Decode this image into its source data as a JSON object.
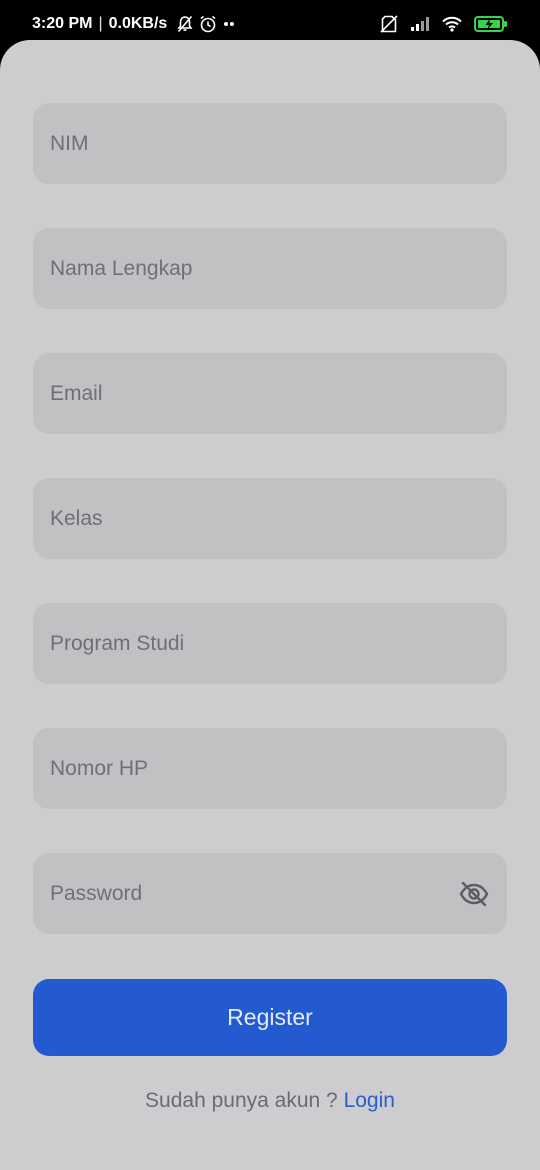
{
  "status_bar": {
    "time": "3:20 PM",
    "separator": "|",
    "network_speed": "0.0KB/s",
    "icons_left": [
      "muted-bell-icon",
      "alarm-clock-icon",
      "more-dots-icon"
    ],
    "icons_right": [
      "no-sim-icon",
      "signal-icon",
      "wifi-icon",
      "battery-charging-icon"
    ]
  },
  "form": {
    "fields": [
      {
        "name": "nim-input",
        "placeholder": "NIM",
        "value": ""
      },
      {
        "name": "nama-lengkap-input",
        "placeholder": "Nama Lengkap",
        "value": ""
      },
      {
        "name": "email-input",
        "placeholder": "Email",
        "value": ""
      },
      {
        "name": "kelas-input",
        "placeholder": "Kelas",
        "value": ""
      },
      {
        "name": "program-studi-input",
        "placeholder": "Program Studi",
        "value": ""
      },
      {
        "name": "nomor-hp-input",
        "placeholder": "Nomor HP",
        "value": ""
      },
      {
        "name": "password-input",
        "placeholder": "Password",
        "value": ""
      }
    ],
    "password_toggle_icon": "eye-off-icon",
    "register_label": "Register"
  },
  "footer": {
    "prompt": "Sudah punya akun ?",
    "login_label": "Login"
  },
  "colors": {
    "background": "#cdcdcf",
    "field_background": "#c1c1c4",
    "primary": "#235ad0",
    "link": "#2a5ec8"
  }
}
